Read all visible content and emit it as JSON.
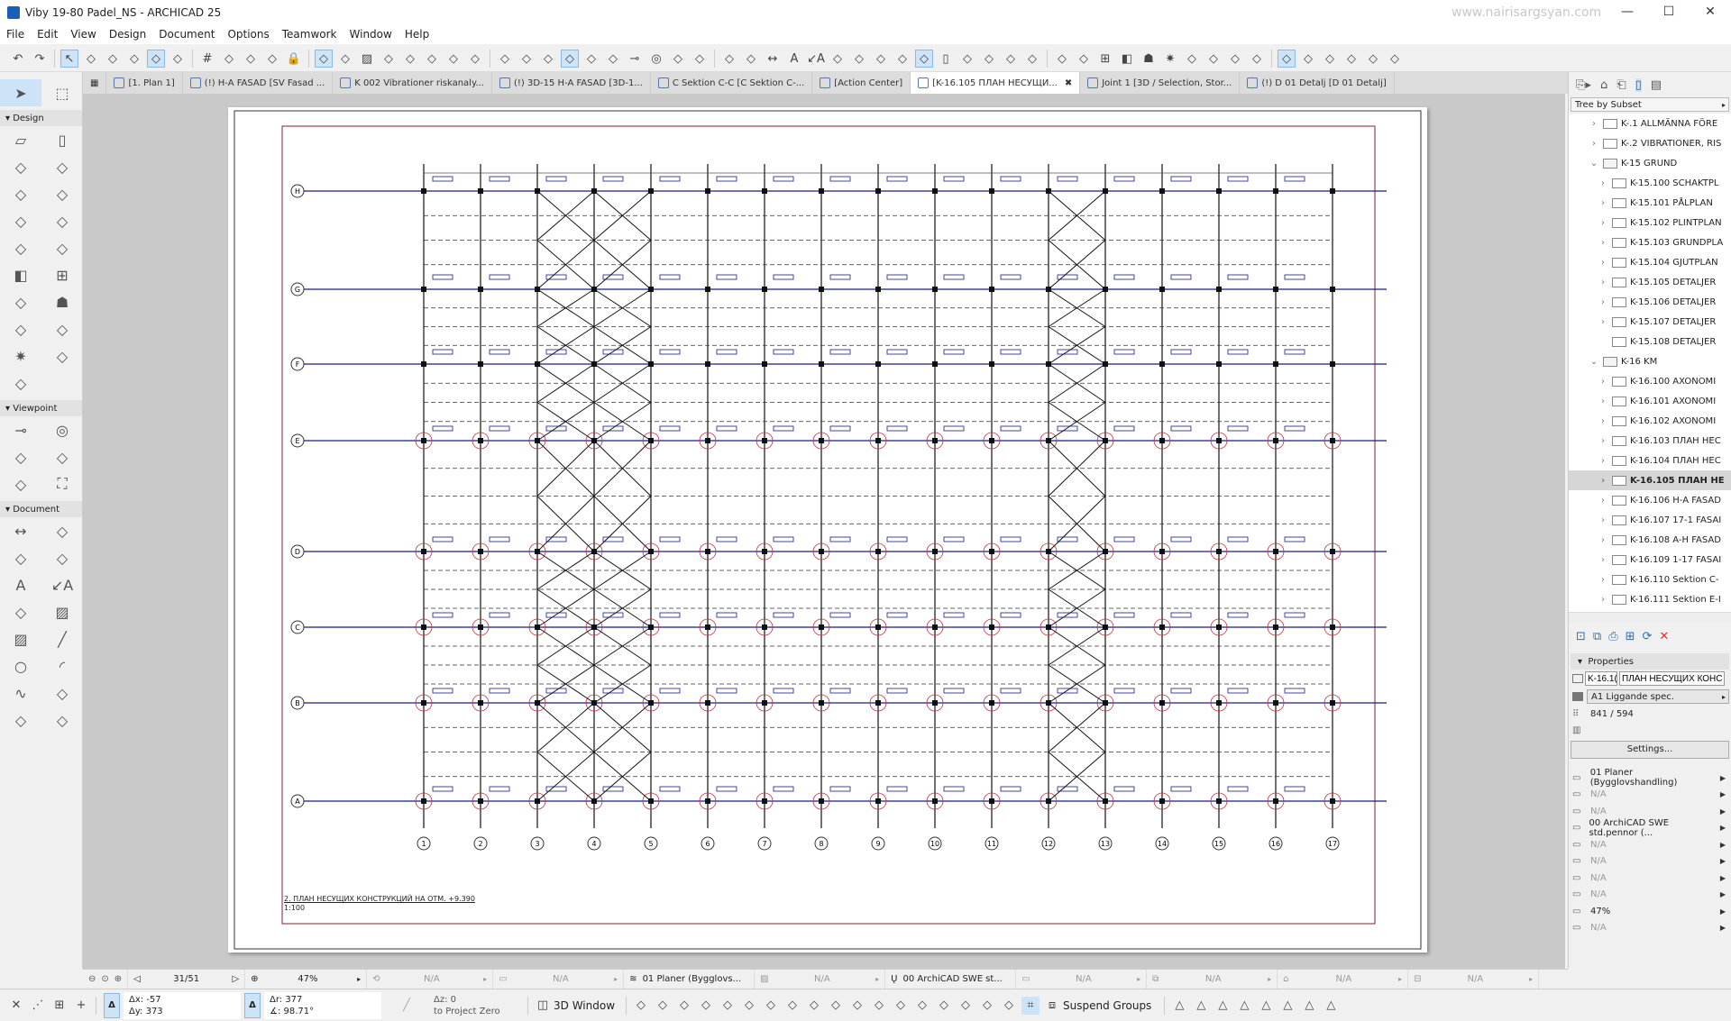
{
  "window": {
    "title": "Viby 19-80 Padel_NS - ARCHICAD 25",
    "watermark": "www.nairisargsyan.com",
    "minimize": "—",
    "maximize": "☐",
    "close": "✕"
  },
  "menu": [
    "File",
    "Edit",
    "View",
    "Design",
    "Document",
    "Options",
    "Teamwork",
    "Window",
    "Help"
  ],
  "toolbar_icons": [
    "undo",
    "redo",
    "pointer",
    "eyedropper",
    "syringe",
    "arrow-tool",
    "marquee",
    "grid-snap",
    "grid",
    "magnet",
    "trace",
    "layer",
    "lock",
    "gravity",
    "renovation",
    "fill",
    "cut",
    "rotate",
    "mirror",
    "offset",
    "split",
    "trim",
    "flag",
    "find-select",
    "publish",
    "mark-up",
    "view",
    "section",
    "elevation",
    "drawing",
    "measure",
    "align",
    "distribute",
    "dimension",
    "text",
    "label",
    "zone",
    "guide",
    "snap",
    "slab",
    "beam",
    "column",
    "stair",
    "roof",
    "mesh",
    "morph",
    "shell",
    "curtain-wall",
    "window",
    "door",
    "object",
    "lamp",
    "level",
    "3d-cut",
    "teamwork-send",
    "teamwork-receive",
    "reserve",
    "release",
    "walls-on",
    "pen-set",
    "display-mode",
    "wireframe"
  ],
  "tabs": [
    {
      "label": "[1. Plan 1]",
      "icon": "floor-plan-icon"
    },
    {
      "label": "(!) H-A FASAD  [SV Fasad ...",
      "icon": "elevation-icon"
    },
    {
      "label": "K 002 Vibrationer riskanaly...",
      "icon": "document-icon"
    },
    {
      "label": "(!) 3D-15 H-A FASAD [3D-1...",
      "icon": "3d-document-icon"
    },
    {
      "label": "C Sektion C-C [C Sektion C-...",
      "icon": "section-icon"
    },
    {
      "label": "[Action Center]",
      "icon": "lighthouse-icon"
    },
    {
      "label": "[K-16.105 ПЛАН НЕСУЩИ...",
      "icon": "layout-icon",
      "active": true,
      "close": "✖"
    },
    {
      "label": "Joint 1 [3D / Selection, Stor...",
      "icon": "3d-icon"
    },
    {
      "label": "(!) D 01 Detalj [D 01 Detalj]",
      "icon": "detail-icon"
    }
  ],
  "toolbox": {
    "design_label": "Design",
    "design_tools": [
      "wall",
      "column",
      "beam",
      "slab",
      "roof",
      "shell",
      "stair",
      "railing",
      "curtain-wall",
      "mesh",
      "door",
      "window",
      "skylight",
      "object",
      "zone",
      "morph",
      "lamp",
      "corner-window",
      "wall-end"
    ],
    "viewpoint_label": "Viewpoint",
    "viewpoint_tools": [
      "section",
      "elevation",
      "interior-elevation",
      "worksheet",
      "detail",
      "camera"
    ],
    "document_label": "Document",
    "document_tools": [
      "dimension",
      "level-dimension",
      "radial-dimension",
      "angle-dimension",
      "text",
      "label",
      "spot-text",
      "fill",
      "hatch",
      "line",
      "circle",
      "arc",
      "spline",
      "hotspot",
      "figure",
      "drawing"
    ]
  },
  "drawing": {
    "title": "2. ПЛАН НЕСУЩИХ КОНСТРУКЦИЙ НА ОТМ. +9.390",
    "scale": "1:100",
    "columns": [
      "1",
      "2",
      "3",
      "4",
      "5",
      "6",
      "7",
      "8",
      "9",
      "10",
      "11",
      "12",
      "13",
      "14",
      "15",
      "16",
      "17"
    ],
    "rows": [
      "H",
      "G",
      "F",
      "E",
      "D",
      "C",
      "B",
      "A"
    ],
    "braced_bays": [
      [
        3,
        4
      ],
      [
        4,
        5
      ],
      [
        12,
        13
      ]
    ]
  },
  "navigator": {
    "header": "Tree by Subset",
    "items": [
      {
        "label": "K-.1 ALLMÄNNA FÖRE",
        "level": 1,
        "type": "layout"
      },
      {
        "label": "K-.2 VIBRATIONER, RIS",
        "level": 1,
        "type": "layout"
      },
      {
        "label": "K-15 GRUND",
        "level": 1,
        "type": "folder",
        "open": true
      },
      {
        "label": "K-15.100 SCHAKTPL",
        "level": 2,
        "type": "layout"
      },
      {
        "label": "K-15.101 PÅLPLAN",
        "level": 2,
        "type": "layout"
      },
      {
        "label": "K-15.102 PLINTPLAN",
        "level": 2,
        "type": "layout"
      },
      {
        "label": "K-15.103 GRUNDPLA",
        "level": 2,
        "type": "layout"
      },
      {
        "label": "K-15.104 GJUTPLAN",
        "level": 2,
        "type": "layout"
      },
      {
        "label": "K-15.105 DETALJER",
        "level": 2,
        "type": "layout"
      },
      {
        "label": "K-15.106 DETALJER",
        "level": 2,
        "type": "layout"
      },
      {
        "label": "K-15.107 DETALJER",
        "level": 2,
        "type": "layout"
      },
      {
        "label": "K-15.108 DETALJER",
        "level": 2,
        "type": "layout",
        "nochev": true
      },
      {
        "label": "K-16 KM",
        "level": 1,
        "type": "folder",
        "open": true
      },
      {
        "label": "K-16.100 AXONOMI",
        "level": 2,
        "type": "layout"
      },
      {
        "label": "K-16.101 AXONOMI",
        "level": 2,
        "type": "layout"
      },
      {
        "label": "K-16.102 AXONOMI",
        "level": 2,
        "type": "layout"
      },
      {
        "label": "K-16.103 ПЛАН НЕС",
        "level": 2,
        "type": "layout"
      },
      {
        "label": "K-16.104 ПЛАН НЕС",
        "level": 2,
        "type": "layout"
      },
      {
        "label": "K-16.105 ПЛАН НЕ",
        "level": 2,
        "type": "layout",
        "selected": true
      },
      {
        "label": "K-16.106 H-A FASAD",
        "level": 2,
        "type": "layout"
      },
      {
        "label": "K-16.107 17-1 FASAI",
        "level": 2,
        "type": "layout"
      },
      {
        "label": "K-16.108 A-H FASAD",
        "level": 2,
        "type": "layout"
      },
      {
        "label": "K-16.109 1-17 FASAI",
        "level": 2,
        "type": "layout"
      },
      {
        "label": "K-16.110 Sektion C-",
        "level": 2,
        "type": "layout"
      },
      {
        "label": "K-16.111 Sektion E-I",
        "level": 2,
        "type": "layout"
      }
    ]
  },
  "properties": {
    "header": "Properties",
    "id": "K-16.1(",
    "name": "ПЛАН НЕСУЩИХ КОНС",
    "master": "A1 Liggande spec.",
    "size": "841 / 594",
    "settings_button": "Settings...",
    "rows": [
      {
        "icon": "layer-combination-icon",
        "value": "01 Planer (Bygglovshandling)",
        "enabled": true
      },
      {
        "icon": "dimension-standard-icon",
        "value": "N/A"
      },
      {
        "icon": "model-view-icon",
        "value": "N/A"
      },
      {
        "icon": "pen-set-icon",
        "value": "00 ArchiCAD SWE std.pennor (...",
        "enabled": true
      },
      {
        "icon": "graphic-override-icon",
        "value": "N/A"
      },
      {
        "icon": "renovation-filter-icon",
        "value": "N/A"
      },
      {
        "icon": "structural-display-icon",
        "value": "N/A"
      },
      {
        "icon": "partial-structure-icon",
        "value": "N/A"
      },
      {
        "icon": "zoom-icon",
        "value": "47%",
        "enabled": true
      },
      {
        "icon": "rotation-icon",
        "value": "N/A"
      }
    ]
  },
  "status_bar": {
    "page": "31/51",
    "zoom": "47%",
    "na": "N/A",
    "layer_combo": "01 Planer (Bygglovs...",
    "pen_set": "00 ArchiCAD SWE st..."
  },
  "coords": {
    "dx": "Δx: -57",
    "dy": "Δy: 373",
    "dr": "Δr: 377",
    "angle": "∡: 98.71°",
    "dz": "Δz: 0",
    "ref": "to Project Zero",
    "delta": "Δ"
  },
  "bottom": {
    "window_3d": "3D Window",
    "suspend_groups": "Suspend Groups"
  },
  "colors": {
    "accent": "#cde3f7",
    "grid_line": "#1a1a8c",
    "marker_red": "#c0303a",
    "frame": "#8a1f2a"
  }
}
